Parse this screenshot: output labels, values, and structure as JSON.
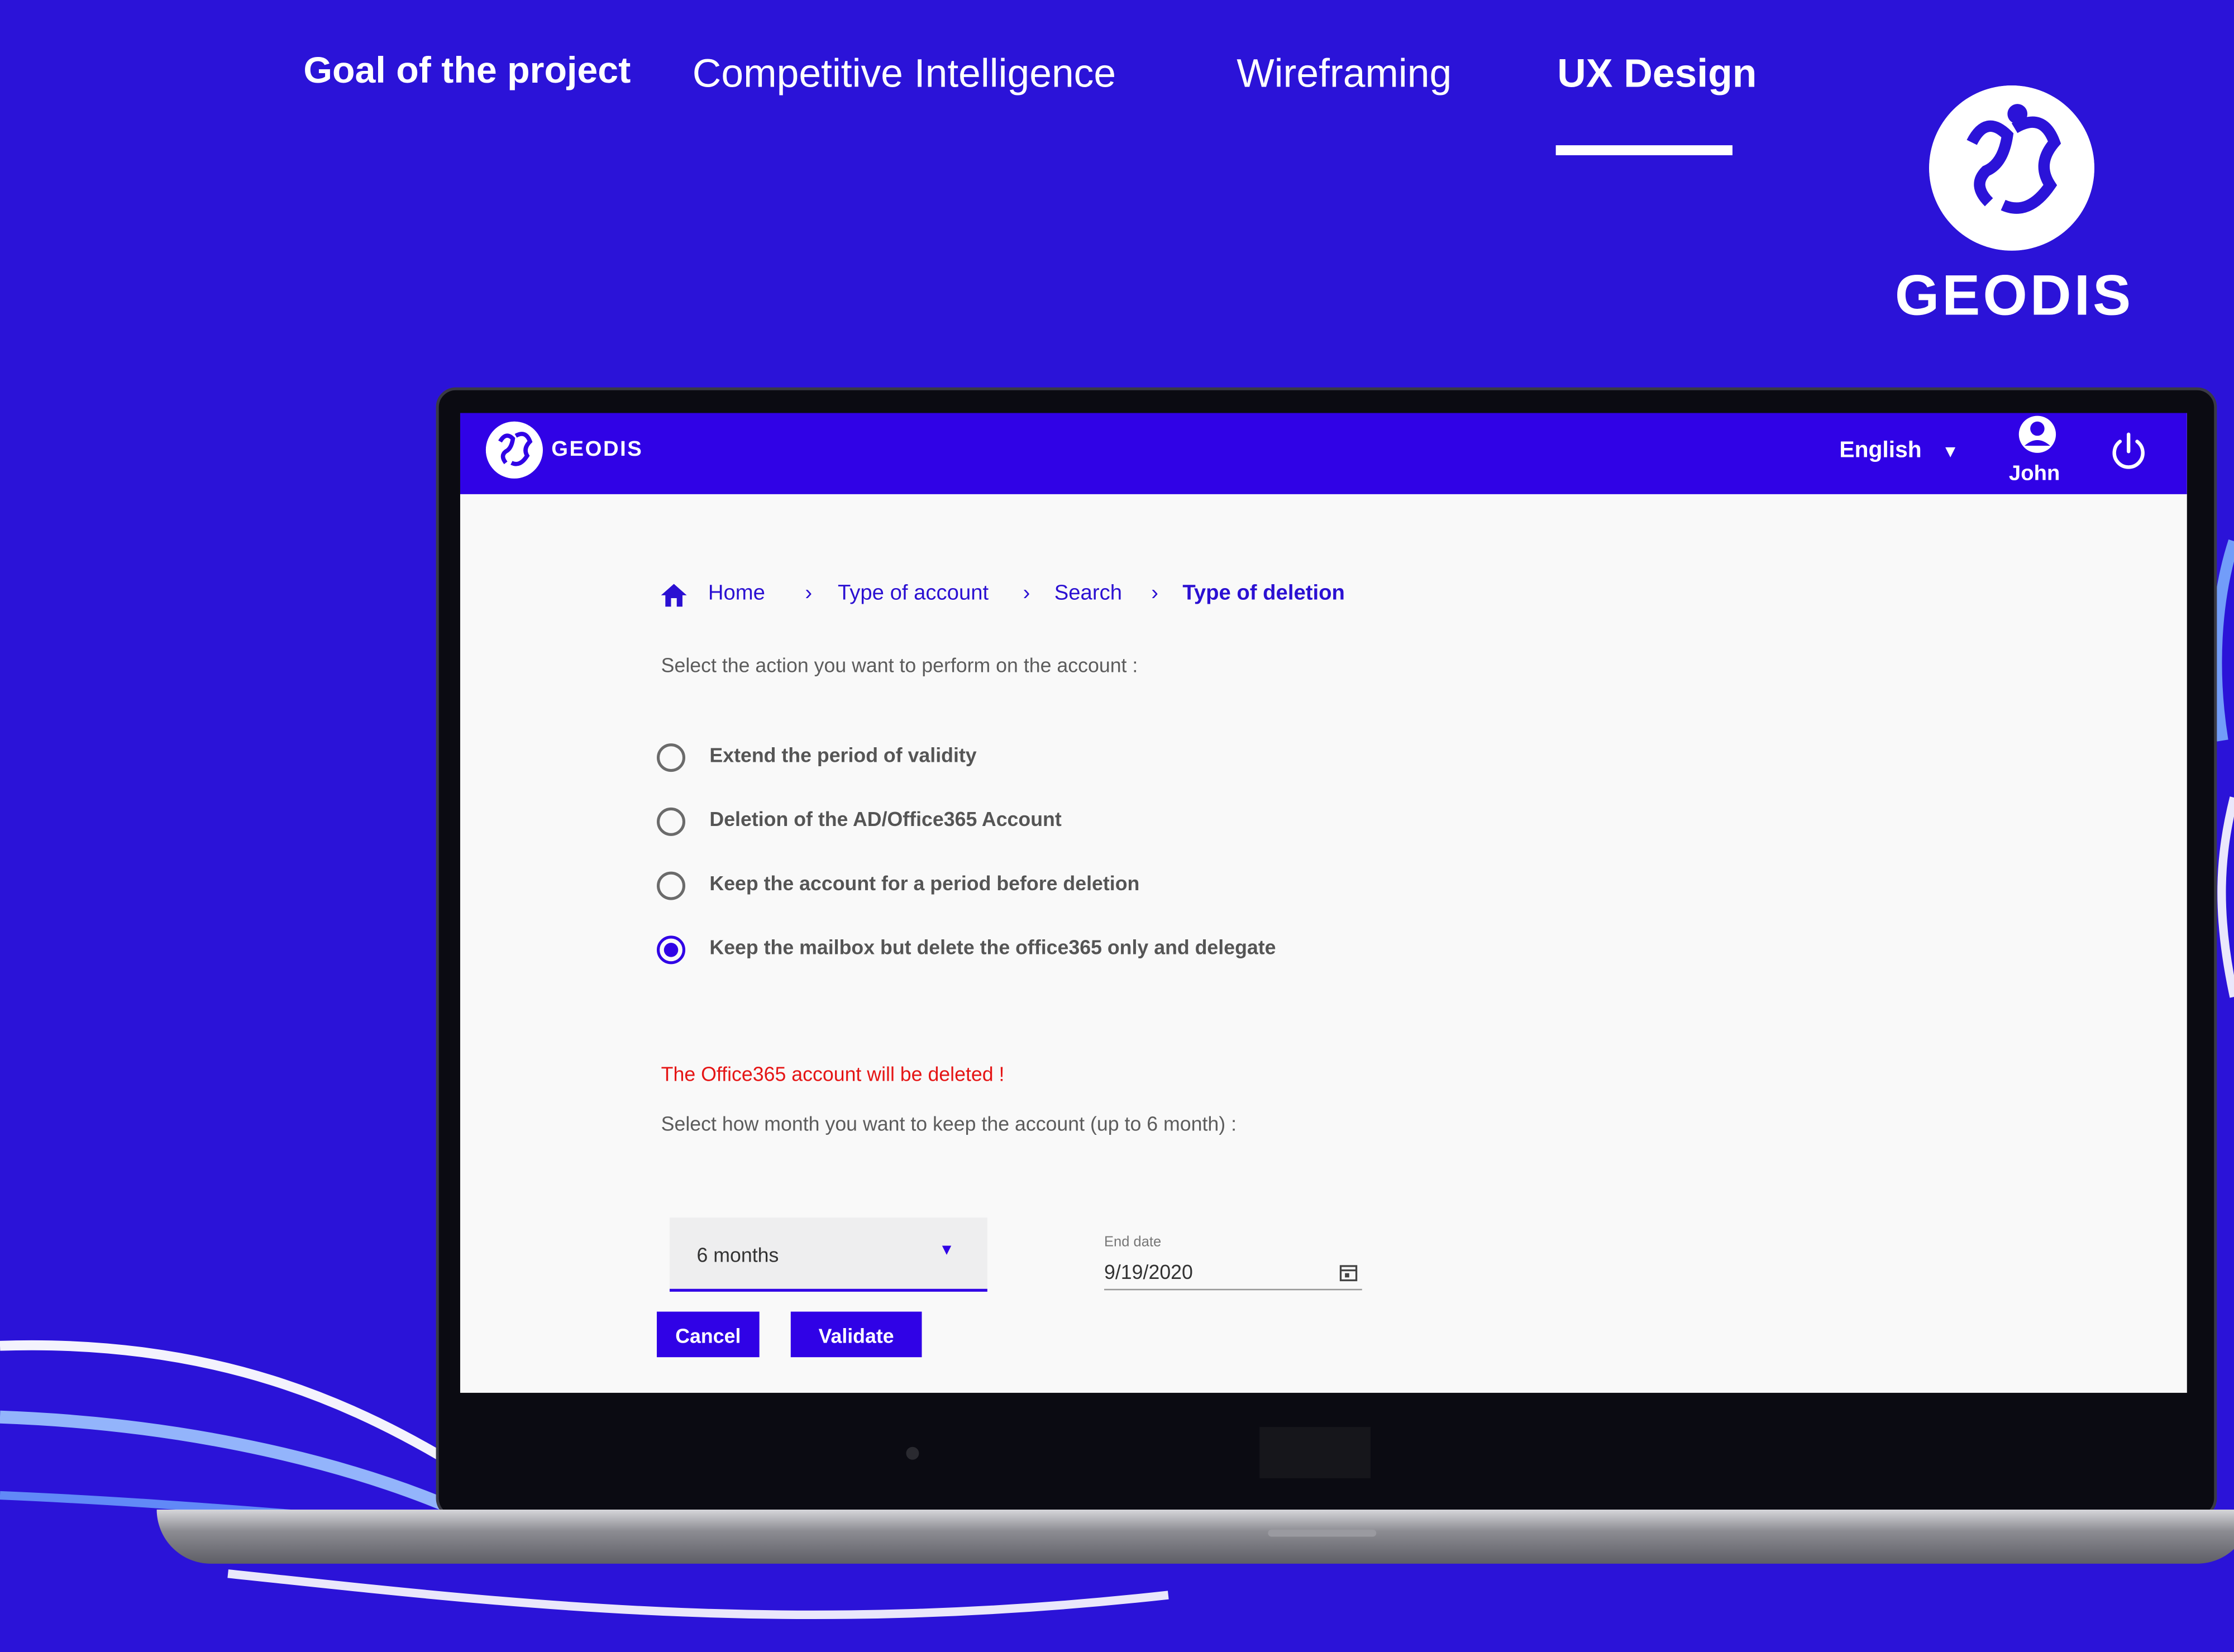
{
  "nav": {
    "items": [
      "Goal of the project",
      "Competitive Intelligence",
      "Wireframing",
      "UX Design"
    ],
    "active": "UX Design"
  },
  "brand": {
    "wordmark": "GEODIS"
  },
  "app": {
    "brand": "GEODIS",
    "language": "English",
    "user": "John",
    "colors": {
      "primary": "#3002e6",
      "warning": "#e51515",
      "background": "#2b13d8"
    }
  },
  "breadcrumb": [
    "Home",
    "Type of account",
    "Search",
    "Type of deletion"
  ],
  "form": {
    "prompt": "Select the action you want to perform on the account :",
    "options": [
      "Extend the period of validity",
      "Deletion of the AD/Office365 Account",
      "Keep the account for a period before deletion",
      "Keep the mailbox but delete the office365 only and delegate"
    ],
    "selected_index": 3,
    "warning": "The Office365 account will be deleted !",
    "duration_prompt": "Select how month you want to keep the account (up to 6 month) :",
    "duration_value": "6 months",
    "end_date_label": "End date",
    "end_date_value": "9/19/2020",
    "cancel_label": "Cancel",
    "validate_label": "Validate"
  }
}
